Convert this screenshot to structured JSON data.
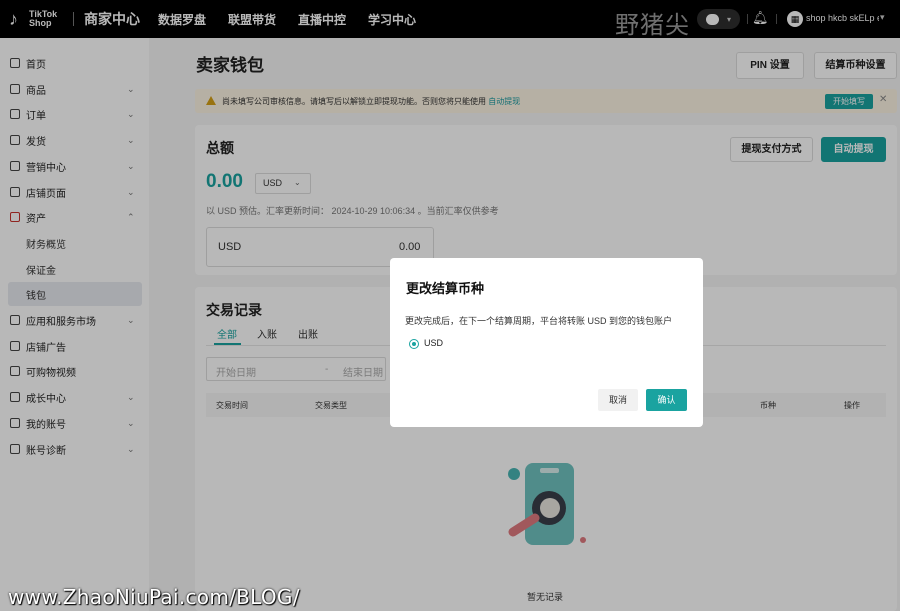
{
  "topbar": {
    "logo_line1": "TikTok",
    "logo_line2": "Shop",
    "brand": "商家中心",
    "nav": [
      "数据罗盘",
      "联盟带货",
      "直播中控",
      "学习中心"
    ],
    "watermark": "野猪尖",
    "shop_name": "shop hkcb skELp ef"
  },
  "sidebar": {
    "items": [
      {
        "label": "首页",
        "icon": "home-icon"
      },
      {
        "label": "商品",
        "icon": "product-icon"
      },
      {
        "label": "订单",
        "icon": "order-icon"
      },
      {
        "label": "发货",
        "icon": "shipping-icon"
      },
      {
        "label": "营销中心",
        "icon": "megaphone-icon"
      },
      {
        "label": "店铺页面",
        "icon": "store-icon"
      },
      {
        "label": "资产",
        "icon": "wallet-icon"
      },
      {
        "label": "应用和服务市场",
        "icon": "apps-icon"
      },
      {
        "label": "店铺广告",
        "icon": "ads-icon"
      },
      {
        "label": "可购物视频",
        "icon": "video-icon"
      },
      {
        "label": "成长中心",
        "icon": "growth-icon"
      },
      {
        "label": "我的账号",
        "icon": "user-icon"
      },
      {
        "label": "账号诊断",
        "icon": "trophy-icon"
      }
    ],
    "sub_items": [
      "财务概览",
      "保证金",
      "钱包"
    ]
  },
  "page": {
    "title": "卖家钱包",
    "pin_button": "PIN 设置",
    "currency_button": "结算币种设置"
  },
  "banner": {
    "text": "尚未填写公司审核信息。请填写后以解锁立即提现功能。否则您将只能使用",
    "link": "自动提现",
    "button": "开始填写"
  },
  "total": {
    "title": "总额",
    "amount": "0.00",
    "currency": "USD",
    "note": "以 USD 预估。汇率更新时间： 2024-10-29 10:06:34 。当前汇率仅供参考",
    "withdraw_method_button": "提现支付方式",
    "auto_withdraw_button": "自动提现",
    "account_currency": "USD",
    "account_value": "0.00"
  },
  "transactions": {
    "title": "交易记录",
    "tabs": [
      "全部",
      "入账",
      "出账"
    ],
    "start_date_placeholder": "开始日期",
    "date_separator": "-",
    "end_date_placeholder": "结束日期",
    "columns": [
      "交易时间",
      "交易类型",
      "币种",
      "操作"
    ],
    "empty": "暂无记录"
  },
  "modal": {
    "title": "更改结算币种",
    "body": "更改完成后，在下一个结算周期，平台将转账 USD 到您的钱包账户",
    "option": "USD",
    "cancel": "取消",
    "confirm": "确认"
  },
  "watermark_bottom": "www.ZhaoNiuPai.com/BLOG/",
  "colors": {
    "accent": "#1aa3a0",
    "topbar": "#000000"
  }
}
